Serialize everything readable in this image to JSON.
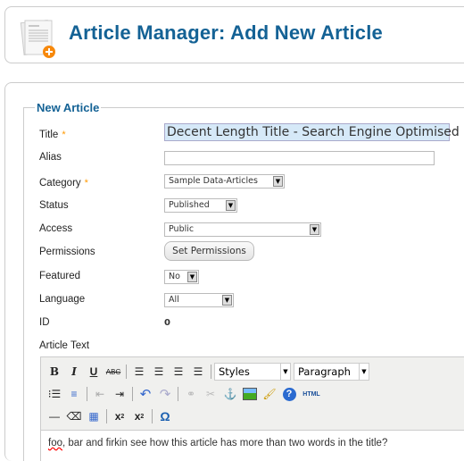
{
  "header": {
    "title": "Article Manager: Add New Article",
    "icon": "article-add-icon"
  },
  "form": {
    "legend": "New Article",
    "title_label": "Title",
    "title_value": "Decent Length Title - Search Engine Optimised",
    "alias_label": "Alias",
    "alias_value": "",
    "category_label": "Category",
    "category_value": "Sample Data-Articles",
    "status_label": "Status",
    "status_value": "Published",
    "access_label": "Access",
    "access_value": "Public",
    "permissions_label": "Permissions",
    "permissions_button": "Set Permissions",
    "featured_label": "Featured",
    "featured_value": "No",
    "language_label": "Language",
    "language_value": "All",
    "id_label": "ID",
    "id_value": "0",
    "article_text_label": "Article Text",
    "required_mark": "*"
  },
  "editor": {
    "styles": "Styles",
    "format": "Paragraph",
    "html": "HTML",
    "content_first": "foo",
    "content_rest": ", bar and firkin see how this article has more than two words in the title?"
  },
  "colors": {
    "heading": "#146295",
    "required": "#ff9900"
  }
}
